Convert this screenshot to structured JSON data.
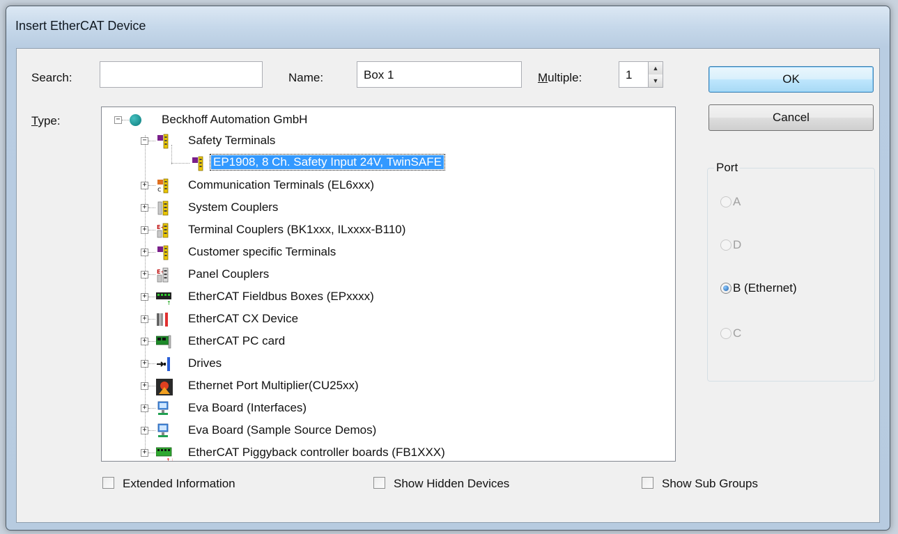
{
  "window": {
    "title": "Insert EtherCAT Device"
  },
  "search": {
    "label": "Search:",
    "value": ""
  },
  "name": {
    "label": "Name:",
    "value": "Box 1"
  },
  "multiple": {
    "label_first": "M",
    "label_rest": "ultiple:",
    "value": "1"
  },
  "type": {
    "label_first": "T",
    "label_rest": "ype:"
  },
  "buttons": {
    "ok": "OK",
    "cancel": "Cancel"
  },
  "tree": {
    "root": {
      "label": "Beckhoff Automation GmbH",
      "icon": "globe-icon"
    },
    "safety": {
      "label": "Safety Terminals",
      "icon": "terminal-icon",
      "expanded": true
    },
    "selected_child": {
      "label": "EP1908, 8 Ch. Safety Input 24V, TwinSAFE",
      "icon": "terminal-icon"
    },
    "items": [
      {
        "label": "Communication Terminals (EL6xxx)",
        "icon": "communication-terminal-icon"
      },
      {
        "label": "System Couplers",
        "icon": "coupler-icon"
      },
      {
        "label": "Terminal Couplers (BK1xxx, ILxxxx-B110)",
        "icon": "terminal-coupler-icon"
      },
      {
        "label": "Customer specific Terminals",
        "icon": "terminal-icon"
      },
      {
        "label": "Panel Couplers",
        "icon": "panel-coupler-icon"
      },
      {
        "label": "EtherCAT Fieldbus Boxes (EPxxxx)",
        "icon": "fieldbus-box-icon"
      },
      {
        "label": "EtherCAT CX Device",
        "icon": "cx-device-icon"
      },
      {
        "label": "EtherCAT PC card",
        "icon": "pc-card-icon"
      },
      {
        "label": "Drives",
        "icon": "drive-icon"
      },
      {
        "label": "Ethernet Port Multiplier(CU25xx)",
        "icon": "port-multiplier-icon"
      },
      {
        "label": "Eva Board (Interfaces)",
        "icon": "eva-board-icon"
      },
      {
        "label": "Eva Board (Sample Source Demos)",
        "icon": "eva-board-icon"
      },
      {
        "label": "EtherCAT Piggyback controller boards (FB1XXX)",
        "icon": "piggyback-board-icon"
      }
    ]
  },
  "port": {
    "title": "Port",
    "options": [
      {
        "label": "A",
        "enabled": false,
        "selected": false
      },
      {
        "label": "D",
        "enabled": false,
        "selected": false
      },
      {
        "label": "B (Ethernet)",
        "enabled": true,
        "selected": true
      },
      {
        "label": "C",
        "enabled": false,
        "selected": false
      }
    ]
  },
  "checkboxes": {
    "extended": {
      "label": "Extended Information",
      "checked": false
    },
    "hidden": {
      "label": "Show Hidden Devices",
      "checked": false
    },
    "subgroups": {
      "label": "Show Sub Groups",
      "checked": false
    }
  }
}
